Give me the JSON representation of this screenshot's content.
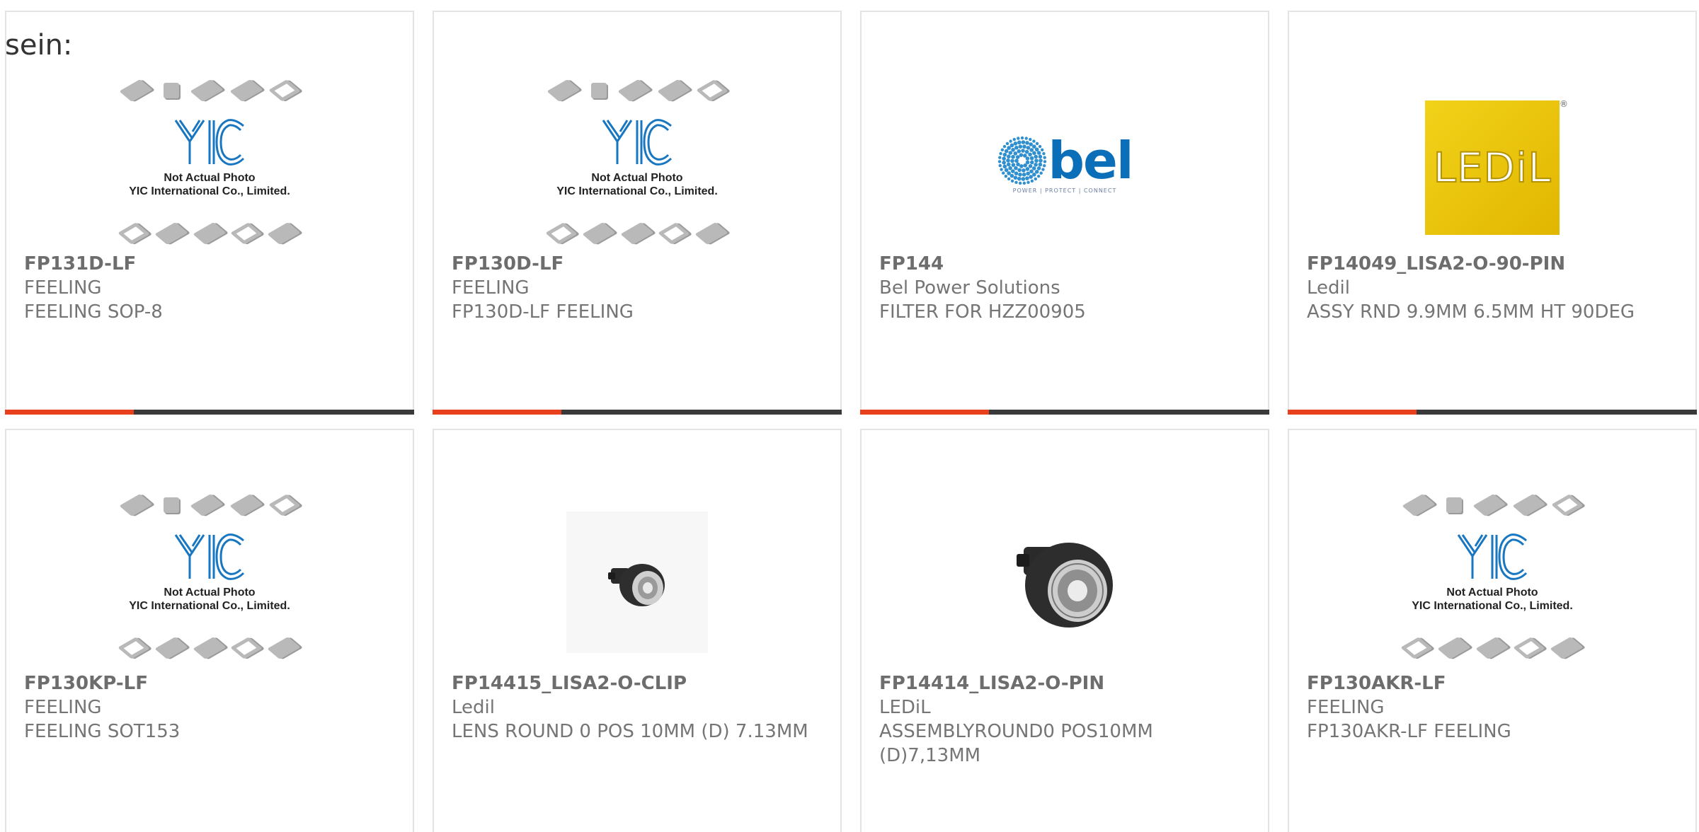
{
  "intro_text": "sein:",
  "products": [
    {
      "part": "FP131D-LF",
      "maker": "FEELING",
      "desc": "FEELING SOP-8",
      "image": "yic-placeholder"
    },
    {
      "part": "FP130D-LF",
      "maker": "FEELING",
      "desc": "FP130D-LF FEELING",
      "image": "yic-placeholder"
    },
    {
      "part": "FP144",
      "maker": "Bel Power Solutions",
      "desc": "FILTER FOR HZZ00905",
      "image": "bel-logo"
    },
    {
      "part": "FP14049_LISA2-O-90-PIN",
      "maker": "Ledil",
      "desc": "ASSY RND 9.9MM 6.5MM HT 90DEG",
      "image": "ledil-logo"
    },
    {
      "part": "FP130KP-LF",
      "maker": "FEELING",
      "desc": "FEELING SOT153",
      "image": "yic-placeholder"
    },
    {
      "part": "FP14415_LISA2-O-CLIP",
      "maker": "Ledil",
      "desc": "LENS ROUND 0 POS 10MM (D) 7.13MM",
      "image": "lens-photo-small"
    },
    {
      "part": "FP14414_LISA2-O-PIN",
      "maker": "LEDiL",
      "desc": "ASSEMBLYROUND0 POS10MM (D)7,13MM",
      "image": "lens-photo-large"
    },
    {
      "part": "FP130AKR-LF",
      "maker": "FEELING",
      "desc": "FP130AKR-LF FEELING",
      "image": "yic-placeholder"
    }
  ],
  "yic": {
    "logo_text": "YIC",
    "caption_line1": "Not Actual Photo",
    "caption_line2": "YIC International Co., Limited."
  },
  "bel": {
    "word": "bel",
    "tagline": "POWER | PROTECT | CONNECT"
  },
  "ledil": {
    "word": "LEDiL",
    "mark": "®"
  },
  "colors": {
    "accent": "#e8401c",
    "bar": "#3a3a3a",
    "border": "#e4e4e4",
    "yic_blue": "#1877c0",
    "bel_blue": "#0a6fb8",
    "ledil_yellow": "#f2d21a"
  }
}
